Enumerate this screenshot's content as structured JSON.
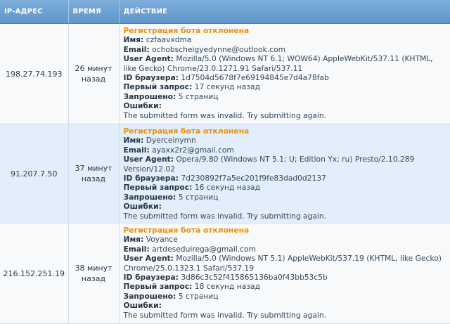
{
  "header": {
    "ip": "IP-АДРЕС",
    "time": "ВРЕМЯ",
    "action": "ДЕЙСТВИЕ"
  },
  "labels": {
    "name": "Имя:",
    "email": "Email:",
    "user_agent": "User Agent:",
    "browser_id": "ID браузера:",
    "first_request": "Первый запрос:",
    "requested": "Запрошено:",
    "errors": "Ошибки:"
  },
  "rows": [
    {
      "ip": "198.27.74.193",
      "time_line1": "26 минут",
      "time_line2": "назад",
      "title": "Регистрация бота отклонена",
      "name": "czfaavxdma",
      "email": "ochobscheigyedynne@outlook.com",
      "user_agent": "Mozilla/5.0 (Windows NT 6.1; WOW64) AppleWebKit/537.11 (KHTML, like Gecko) Chrome/23.0.1271.91 Safari/537.11",
      "browser_id": "1d7504d5678f7e69194845e7d4a78fab",
      "first_request": "17 секунд назад",
      "requested": "5 страниц",
      "error": "The submitted form was invalid. Try submitting again."
    },
    {
      "ip": "91.207.7.50",
      "time_line1": "37 минут",
      "time_line2": "назад",
      "title": "Регистрация бота отклонена",
      "name": "Dyerceinymn",
      "email": "ayaxx2r2@gmail.com",
      "user_agent": "Opera/9.80 (Windows NT 5.1; U; Edition Yx; ru) Presto/2.10.289 Version/12.02",
      "browser_id": "7d230892f7a5ec201f9fe83dad0d2137",
      "first_request": "16 секунд назад",
      "requested": "5 страниц",
      "error": "The submitted form was invalid. Try submitting again."
    },
    {
      "ip": "216.152.251.19",
      "time_line1": "38 минут",
      "time_line2": "назад",
      "title": "Регистрация бота отклонена",
      "name": "Voyance",
      "email": "artdeseduirega@gmail.com",
      "user_agent": "Mozilla/5.0 (Windows NT 5.1) AppleWebKit/537.19 (KHTML, like Gecko) Chrome/25.0.1323.1 Safari/537.19",
      "browser_id": "3d86c3c52f415865136ba0f43bb53c5b",
      "first_request": "18 секунд назад",
      "requested": "5 страниц",
      "error": "The submitted form was invalid. Try submitting again."
    }
  ],
  "colors": {
    "header_bg": "#6b9fd0",
    "title": "#e8910c",
    "row_odd": "#f7f9fb",
    "row_even": "#e3eefb"
  }
}
